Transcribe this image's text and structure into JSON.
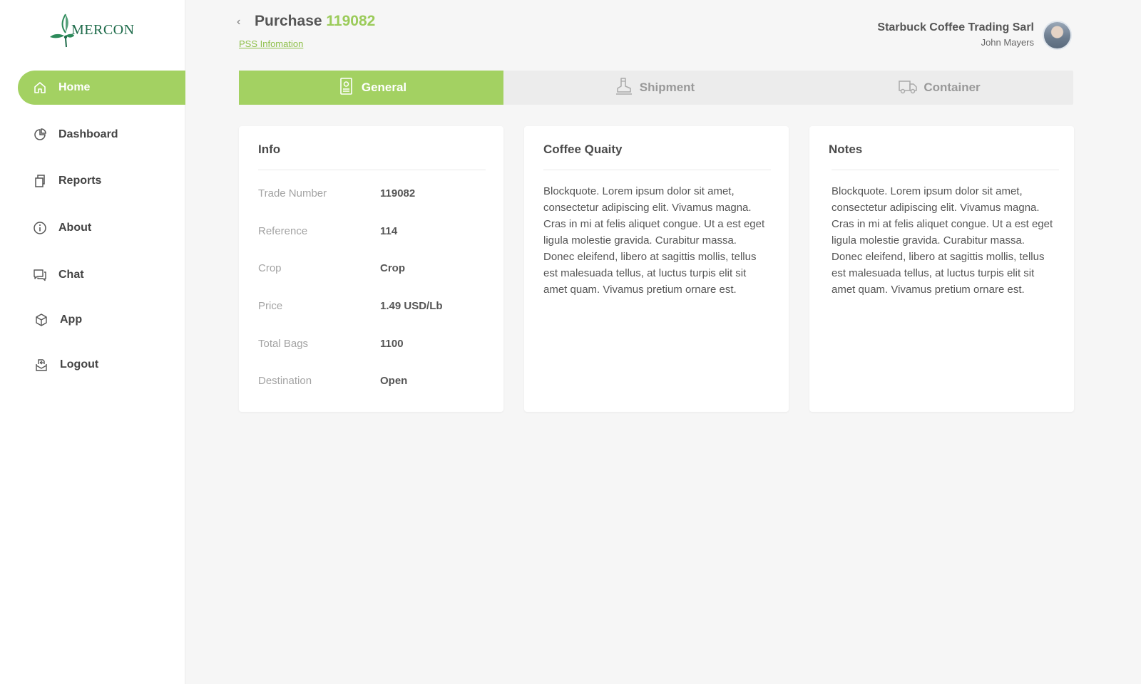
{
  "brand": {
    "name": "MERCON",
    "accent": "#a3d162",
    "logo_color": "#1e6b4a"
  },
  "sidebar": {
    "items": [
      {
        "label": "Home",
        "icon": "home-icon",
        "active": true
      },
      {
        "label": "Dashboard",
        "icon": "pie-chart-icon",
        "active": false
      },
      {
        "label": "Reports",
        "icon": "copy-icon",
        "active": false
      },
      {
        "label": "About",
        "icon": "info-icon",
        "active": false
      },
      {
        "label": "Chat",
        "icon": "chat-icon",
        "active": false
      },
      {
        "label": "App",
        "icon": "cube-icon",
        "active": false
      },
      {
        "label": "Logout",
        "icon": "logout-icon",
        "active": false
      }
    ]
  },
  "header": {
    "back_icon": "chevron-left-icon",
    "title_prefix": "Purchase",
    "title_number": "119082",
    "sub_link": "PSS Infomation"
  },
  "user": {
    "company": "Starbuck Coffee Trading Sarl",
    "name": "John Mayers"
  },
  "tabs": [
    {
      "label": "General",
      "icon": "document-icon",
      "active": true
    },
    {
      "label": "Shipment",
      "icon": "boot-icon",
      "active": false
    },
    {
      "label": "Container",
      "icon": "truck-icon",
      "active": false
    }
  ],
  "info_card": {
    "title": "Info",
    "rows": [
      {
        "label": "Trade Number",
        "value": "119082"
      },
      {
        "label": "Reference",
        "value": "114"
      },
      {
        "label": "Crop",
        "value": "Crop"
      },
      {
        "label": "Price",
        "value": "1.49 USD/Lb"
      },
      {
        "label": "Total Bags",
        "value": "1100"
      },
      {
        "label": "Destination",
        "value": "Open"
      }
    ]
  },
  "quality_card": {
    "title": "Coffee Quaity",
    "text": "Blockquote. Lorem ipsum dolor sit amet, consectetur adipiscing elit. Vivamus magna. Cras in mi at felis aliquet congue. Ut a est eget ligula molestie gravida. Curabitur massa. Donec eleifend, libero at sagittis mollis, tellus est malesuada tellus, at luctus turpis elit sit amet quam. Vivamus pretium ornare est."
  },
  "notes_card": {
    "title": "Notes",
    "text": "Blockquote. Lorem ipsum dolor sit amet, consectetur adipiscing elit. Vivamus magna. Cras in mi at felis aliquet congue. Ut a est eget ligula molestie gravida. Curabitur massa. Donec eleifend, libero at sagittis mollis, tellus est malesuada tellus, at luctus turpis elit sit amet quam. Vivamus pretium ornare est."
  }
}
